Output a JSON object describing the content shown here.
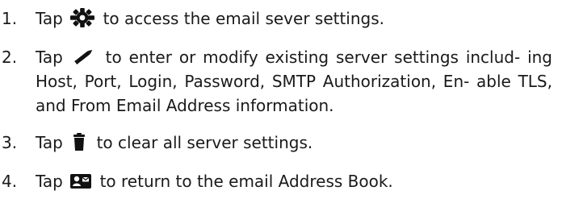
{
  "steps": [
    {
      "number": "1.",
      "prefix": "Tap",
      "icon": "gear-icon",
      "suffix": "to access the email sever settings."
    },
    {
      "number": "2.",
      "prefix": "Tap",
      "icon": "pencil-icon",
      "suffix": "to enter or modify existing server settings includ- ing Host, Port, Login, Password, SMTP Authorization, En- able TLS, and From Email Address information."
    },
    {
      "number": "3.",
      "prefix": "Tap",
      "icon": "trash-icon",
      "suffix": "to clear all server settings."
    },
    {
      "number": "4.",
      "prefix": "Tap",
      "icon": "address-book-icon",
      "suffix": "to return to the email Address Book."
    }
  ]
}
